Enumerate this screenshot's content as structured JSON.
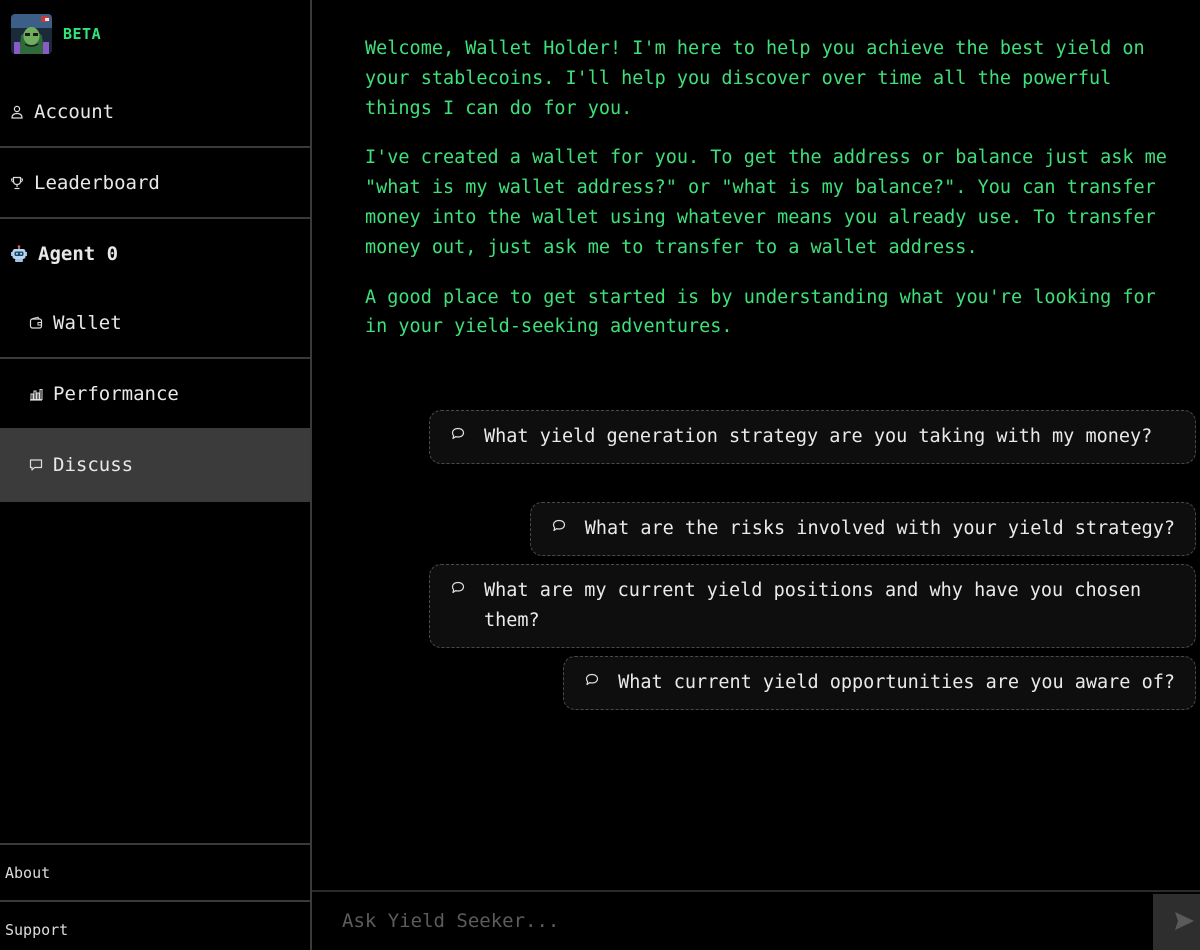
{
  "brand": {
    "badge": "BETA"
  },
  "nav": {
    "account": "Account",
    "leaderboard": "Leaderboard",
    "agent": "Agent 0",
    "wallet": "Wallet",
    "performance": "Performance",
    "discuss": "Discuss",
    "active": "Discuss"
  },
  "footer": {
    "about": "About",
    "support": "Support"
  },
  "chat": {
    "welcome": [
      "Welcome, Wallet Holder! I'm here to help you achieve the best yield on your stablecoins. I'll help you discover over time all the powerful things I can do for you.",
      "I've created a wallet for you. To get the address or balance just ask me \"what is my wallet address?\" or \"what is my balance?\". You can transfer money into the wallet using whatever means you already use. To transfer money out, just ask me to transfer to a wallet address.",
      "A good place to get started is by understanding what you're looking for in your yield-seeking adventures."
    ],
    "suggestions": [
      "What yield generation strategy are you taking with my money?",
      "What are the risks involved with your yield strategy?",
      "What are my current yield positions and why have you chosen them?",
      "What current yield opportunities are you aware of?"
    ]
  },
  "input": {
    "placeholder": "Ask Yield Seeker..."
  },
  "colors": {
    "accent": "#3fe07a",
    "beta": "#2fe67a",
    "active_bg": "#3b3b3b",
    "border": "#3a3a3a"
  }
}
